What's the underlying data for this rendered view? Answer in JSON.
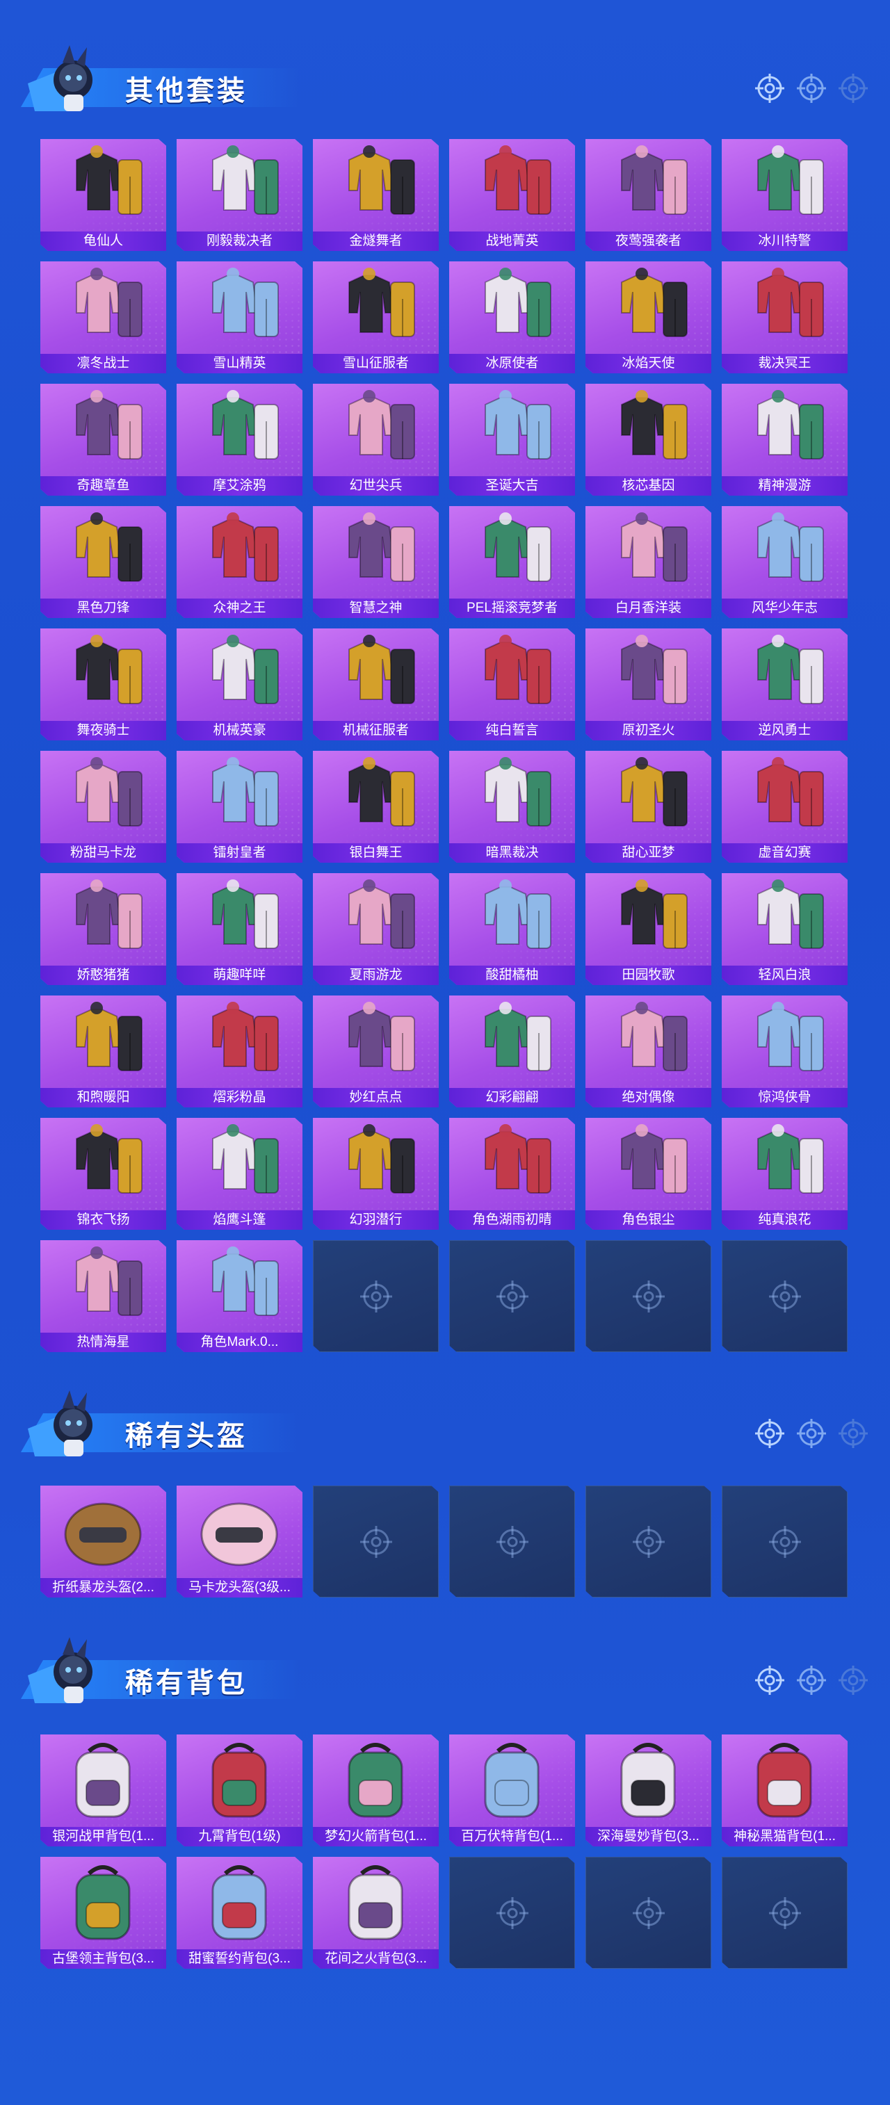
{
  "sections": [
    {
      "title": "其他套装",
      "items": [
        "龟仙人",
        "刚毅裁决者",
        "金燧舞者",
        "战地菁英",
        "夜莺强袭者",
        "冰川特警",
        "凛冬战士",
        "雪山精英",
        "雪山征服者",
        "冰原使者",
        "冰焰天使",
        "裁决冥王",
        "奇趣章鱼",
        "摩艾涂鸦",
        "幻世尖兵",
        "圣诞大吉",
        "核芯基因",
        "精神漫游",
        "黑色刀锋",
        "众神之王",
        "智慧之神",
        "PEL摇滚竞梦者",
        "白月香洋装",
        "风华少年志",
        "舞夜骑士",
        "机械英豪",
        "机械征服者",
        "纯白誓言",
        "原初圣火",
        "逆风勇士",
        "粉甜马卡龙",
        "镭射皇者",
        "银白舞王",
        "暗黑裁决",
        "甜心亚梦",
        "虚音幻赛",
        "娇憨猪猪",
        "萌趣咩咩",
        "夏雨游龙",
        "酸甜橘柚",
        "田园牧歌",
        "轻风白浪",
        "和煦暖阳",
        "熠彩粉晶",
        "妙红点点",
        "幻彩翩翩",
        "绝对偶像",
        "惊鸿侠骨",
        "锦衣飞扬",
        "焰鹰斗篷",
        "幻羽潜行",
        "角色湖雨初晴",
        "角色银尘",
        "纯真浪花",
        "热情海星",
        "角色Mark.0..."
      ],
      "empty_slots": 4
    },
    {
      "title": "稀有头盔",
      "items": [
        "折纸暴龙头盔(2...",
        "马卡龙头盔(3级..."
      ],
      "empty_slots": 4
    },
    {
      "title": "稀有背包",
      "items": [
        "银河战甲背包(1...",
        "九霄背包(1级)",
        "梦幻火箭背包(1...",
        "百万伏特背包(1...",
        "深海曼妙背包(3...",
        "神秘黑猫背包(1...",
        "古堡领主背包(3...",
        "甜蜜誓约背包(3...",
        "花间之火背包(3..."
      ],
      "empty_slots": 3
    }
  ]
}
